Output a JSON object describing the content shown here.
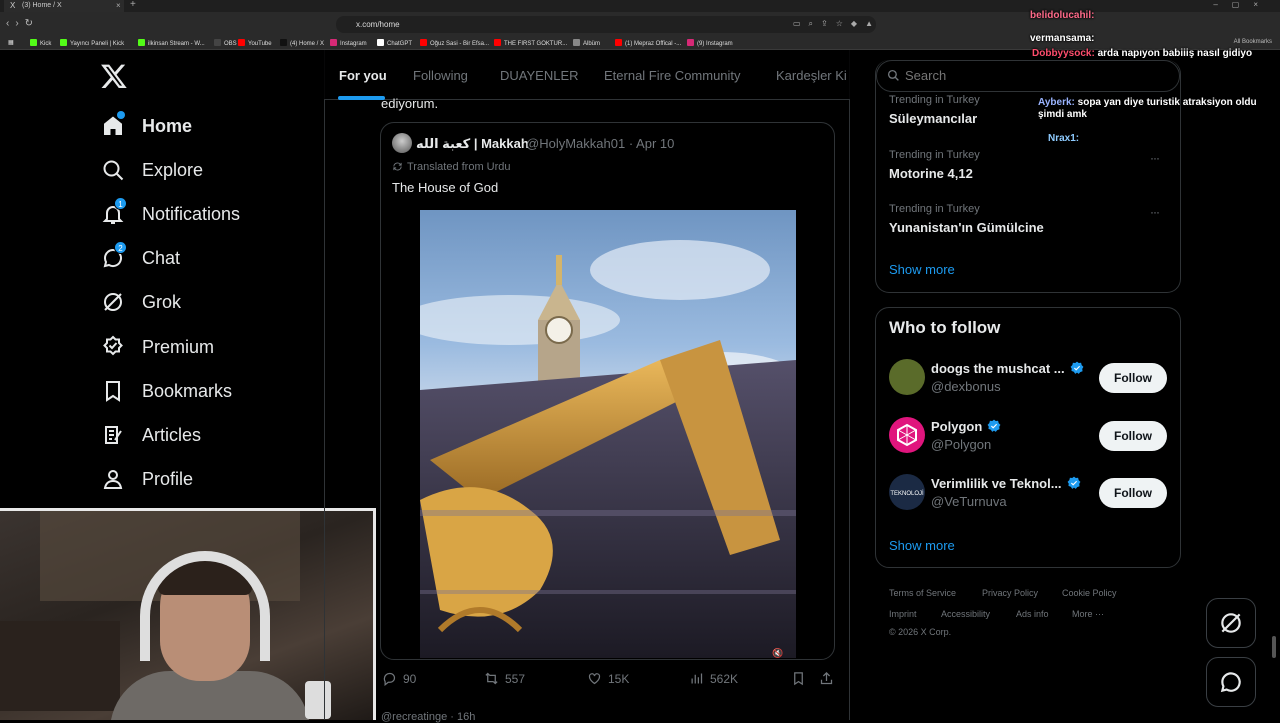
{
  "browser": {
    "tab_title": "(3) Home / X",
    "url": "x.com/home",
    "bookmarks": [
      {
        "label": "Kick",
        "color": "#53fc18"
      },
      {
        "label": "Yayıncı Paneli | Kick",
        "color": "#53fc18"
      },
      {
        "label": "ilkinsan Stream - W...",
        "color": "#53fc18"
      },
      {
        "label": "OBS",
        "color": "#444444"
      },
      {
        "label": "YouTube",
        "color": "#ff0000"
      },
      {
        "label": "(4) Home / X",
        "color": "#111111"
      },
      {
        "label": "Instagram",
        "color": "#d62976"
      },
      {
        "label": "ChatGPT",
        "color": "#ffffff"
      },
      {
        "label": "Oğuz Sasi - Bir Efsa...",
        "color": "#ff0000"
      },
      {
        "label": "THE FIRST GOKTUR...",
        "color": "#ff0000"
      },
      {
        "label": "Albüm",
        "color": "#888888"
      },
      {
        "label": "(1) Mepraz Offical -...",
        "color": "#ff0000"
      },
      {
        "label": "(9) Instagram",
        "color": "#d62976"
      }
    ],
    "all_bookmarks": "All Bookmarks"
  },
  "sidebar": {
    "logo": "X",
    "items": [
      {
        "label": "Home",
        "icon": "home-icon",
        "badge": ""
      },
      {
        "label": "Explore",
        "icon": "search-icon",
        "badge": ""
      },
      {
        "label": "Notifications",
        "icon": "bell-icon",
        "badge": "1"
      },
      {
        "label": "Chat",
        "icon": "chat-icon",
        "badge": "2"
      },
      {
        "label": "Grok",
        "icon": "grok-icon",
        "badge": ""
      },
      {
        "label": "Premium",
        "icon": "premium-icon",
        "badge": ""
      },
      {
        "label": "Bookmarks",
        "icon": "bookmark-icon",
        "badge": ""
      },
      {
        "label": "Articles",
        "icon": "articles-icon",
        "badge": ""
      },
      {
        "label": "Profile",
        "icon": "profile-icon",
        "badge": ""
      }
    ]
  },
  "feed": {
    "tabs": [
      "For you",
      "Following",
      "DUAYENLER",
      "Eternal Fire Community",
      "Kardeşler Ki"
    ],
    "active_tab": "For you",
    "prev_text_fragment": "ediyorum.",
    "quote": {
      "name": "كعبة الله | Makkah",
      "handle": "@HolyMakkah01",
      "date": "Apr 10",
      "translated": "Translated from Urdu",
      "text": "The House of God"
    },
    "actions": {
      "replies": "90",
      "reposts": "557",
      "likes": "15K",
      "views": "562K"
    },
    "next_post_fragment": "@recreatinge · 16h"
  },
  "search": {
    "placeholder": "Search"
  },
  "trends": [
    {
      "meta": "Trending in Turkey",
      "name": "Süleymancılar"
    },
    {
      "meta": "Trending in Turkey",
      "name": "Motorine 4,12"
    },
    {
      "meta": "Trending in Turkey",
      "name": "Yunanistan'ın Gümülcine"
    }
  ],
  "trends_show_more": "Show more",
  "who_to_follow": {
    "title": "Who to follow",
    "accounts": [
      {
        "name": "doogs the mushcat ...",
        "handle": "@dexbonus",
        "button": "Follow",
        "avatar_color": "#5a6b2a"
      },
      {
        "name": "Polygon",
        "handle": "@Polygon",
        "button": "Follow",
        "avatar_color": "#e0157d"
      },
      {
        "name": "Verimlilik ve Teknol...",
        "handle": "@VeTurnuva",
        "button": "Follow",
        "avatar_color": "#1b2a44"
      }
    ],
    "show_more": "Show more"
  },
  "footer": {
    "links_row1": [
      "Terms of Service",
      "Privacy Policy",
      "Cookie Policy"
    ],
    "links_row2": [
      "Imprint",
      "Accessibility",
      "Ads info",
      "More ···"
    ],
    "copyright": "© 2026 X Corp."
  },
  "stream_chat": [
    {
      "user": "belidolucahil:",
      "text": "",
      "color": "#ff6b8a"
    },
    {
      "user": "vermansama:",
      "text": "",
      "color": "#ffffff"
    },
    {
      "user": "Dobbyysock:",
      "text": "arda napıyon babiiiş nasıl gidiyo",
      "color": "#ff4d6d"
    },
    {
      "user": "Ayberk:",
      "text": "sopa yan diye turistik atraksiyon oldu şimdi amk",
      "color": "#9ab4ff"
    },
    {
      "user": "Nrax1:",
      "text": "",
      "color": "#8ecbff"
    }
  ]
}
